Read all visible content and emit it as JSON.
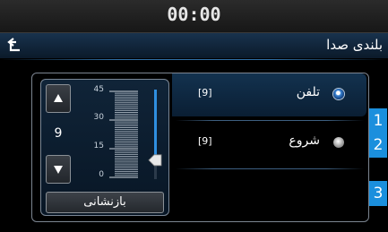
{
  "status_bar": {
    "time": "00:00"
  },
  "header": {
    "title": "بلندی صدا",
    "back_icon": "back-arrow-icon"
  },
  "volume": {
    "value": "9",
    "up_icon": "triangle-up-icon",
    "down_icon": "triangle-down-icon",
    "scale_max": 45,
    "scale_ticks": [
      "45",
      "30",
      "15",
      "0"
    ],
    "reset_label": "بازنشانی",
    "accent": "#2f8fe0"
  },
  "rows": [
    {
      "number": "1",
      "label": "تلفن",
      "value": "[9]",
      "selected": true
    },
    {
      "number": "2",
      "label": "شروع",
      "value": "[9]",
      "selected": false
    },
    {
      "number": "3",
      "label": "",
      "value": "",
      "selected": false
    }
  ],
  "colors": {
    "badge": "#1b8fdd",
    "selected_row": "#13324f"
  }
}
